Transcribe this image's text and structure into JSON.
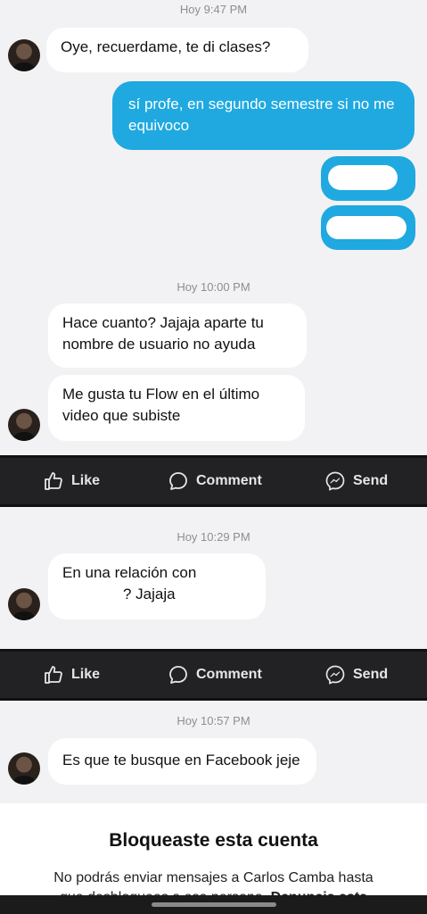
{
  "screens": [
    {
      "timestamp": "Hoy 9:47 PM",
      "messages": [
        {
          "side": "in",
          "text": "Oye, recuerdame, te di clases?"
        },
        {
          "side": "out",
          "text": "sí profe, en segundo semestre si no me equivoco"
        }
      ]
    },
    {
      "timestamp": "Hoy 10:00 PM",
      "messages": [
        {
          "side": "in",
          "text": "Hace cuanto? Jajaja aparte tu nombre de usuario no ayuda"
        },
        {
          "side": "in",
          "text": "Me gusta tu Flow en el último video que subiste"
        }
      ]
    },
    {
      "timestamp": "Hoy 10:29 PM",
      "messages": [
        {
          "side": "in",
          "line1": "En una relación con",
          "line2": "? Jajaja"
        }
      ]
    },
    {
      "timestamp": "Hoy 10:57 PM",
      "messages": [
        {
          "side": "in",
          "text": "Es que te busque en Facebook jeje"
        }
      ]
    }
  ],
  "fb_actions": {
    "like": "Like",
    "comment": "Comment",
    "send": "Send"
  },
  "blocked": {
    "title": "Bloqueaste esta cuenta",
    "line1": "No podrás enviar mensajes a Carlos Camba hasta",
    "line2_start": "que desbloquees a esa persona.",
    "line2_link": "Denuncia esta"
  },
  "colors": {
    "outgoing": "#1fa9e0",
    "incoming": "#ffffff",
    "bar": "#222224"
  }
}
